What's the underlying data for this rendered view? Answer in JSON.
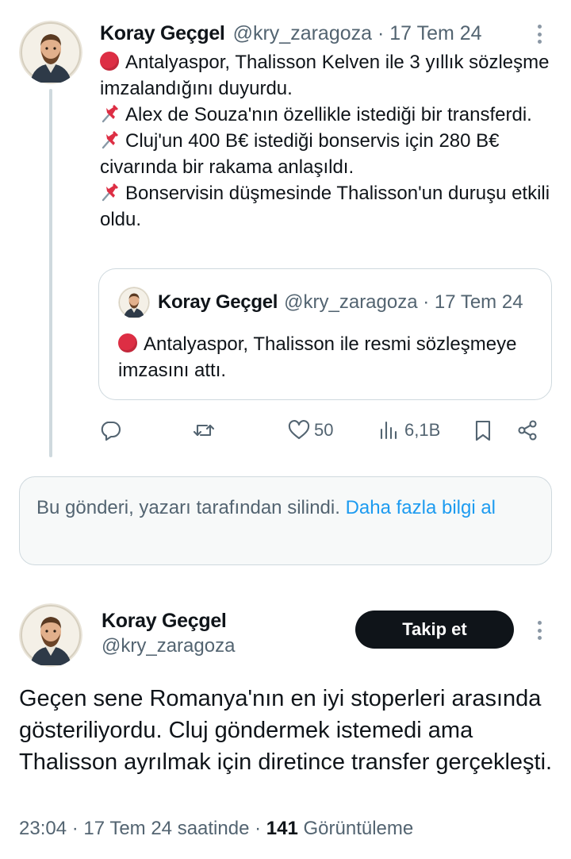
{
  "tweet1": {
    "author_name": "Koray Geçgel",
    "handle": "@kry_zaragoza",
    "date_sep": " · ",
    "date": "17 Tem 24",
    "lines": [
      {
        "icon": "red-circle-icon",
        "text": "Antalyaspor, Thalisson Kelven ile 3 yıllık sözleşme imzalandığını duyurdu."
      },
      {
        "icon": "pushpin-icon",
        "text": "Alex de Souza'nın özellikle istediği bir transferdi."
      },
      {
        "icon": "pushpin-icon",
        "text": "Cluj'un 400 B€ istediği bonservis için 280 B€ civarında bir rakama anlaşıldı."
      },
      {
        "icon": "pushpin-icon",
        "text": "Bonservisin düşmesinde Thalisson'un duruşu etkili oldu."
      }
    ],
    "quote": {
      "author_name": "Koray Geçgel",
      "handle": "@kry_zaragoza",
      "date_sep": " · ",
      "date": "17 Tem 24",
      "icon": "red-circle-icon",
      "text": "Antalyaspor, Thalisson ile resmi sözleşmeye imzasını attı."
    },
    "actions": {
      "likes": "50",
      "views": "6,1B"
    }
  },
  "deleted_notice": {
    "text": "Bu gönderi, yazarı tarafından silindi.",
    "link": "Daha fazla bilgi al"
  },
  "tweet2": {
    "author_name": "Koray Geçgel",
    "handle": "@kry_zaragoza",
    "follow_label": "Takip et",
    "text": "Geçen sene Romanya'nın en iyi stoperleri arasında gösteriliyordu. Cluj göndermek istemedi ama Thalisson ayrılmak için diretince transfer gerçekleşti.",
    "time": "23:04",
    "date": "17 Tem 24 saatinde",
    "views_count": "141",
    "views_label": "Görüntüleme"
  },
  "colors": {
    "link": "#1d9bf0",
    "muted_text": "#536471",
    "follow_button_bg": "#0f1419",
    "red_circle": "#dd2e44",
    "divider": "#cfd9de"
  }
}
